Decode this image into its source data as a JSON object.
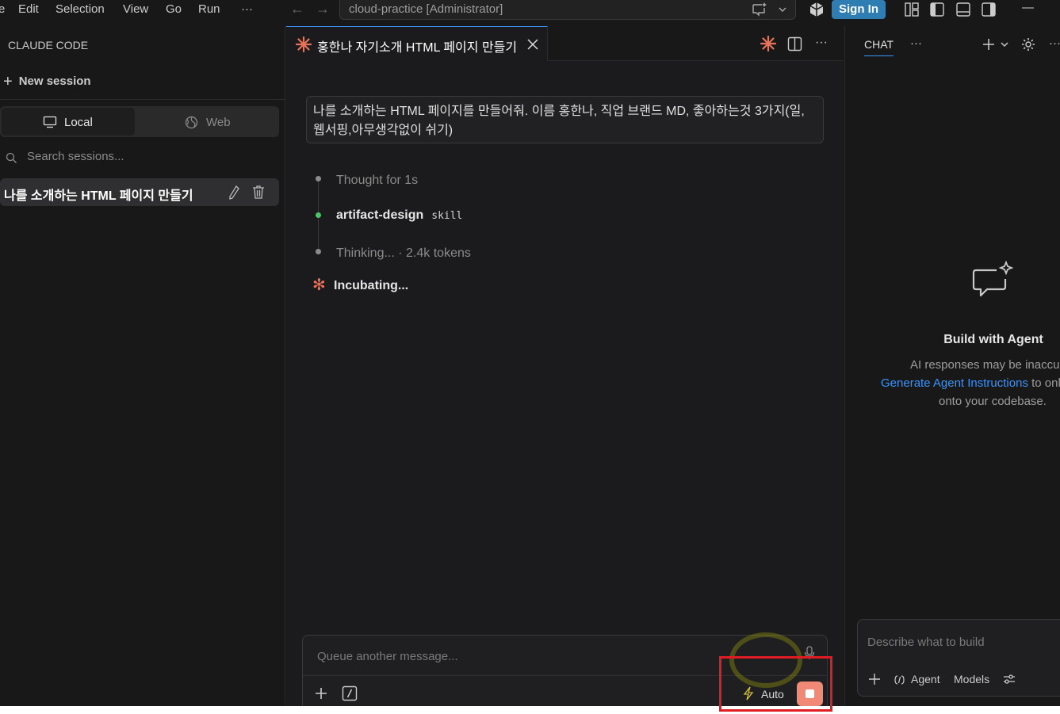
{
  "titlebar": {
    "menu": [
      "e",
      "Edit",
      "Selection",
      "View",
      "Go",
      "Run",
      "···"
    ],
    "command_center": "cloud-practice [Administrator]",
    "sign_in": "Sign In",
    "minimize": "—"
  },
  "sidebar": {
    "title": "CLAUDE CODE",
    "new_session": "New session",
    "mode_tabs": [
      {
        "label": "Local",
        "icon": "monitor-icon",
        "selected": true
      },
      {
        "label": "Web",
        "icon": "globe-icon",
        "selected": false
      }
    ],
    "search_placeholder": "Search sessions...",
    "sessions": [
      {
        "label": "나를 소개하는 HTML 페이지 만들기",
        "active": true
      }
    ]
  },
  "editor": {
    "tab_title": "홍한나 자기소개 HTML 페이지 만들기",
    "user_message": "나를 소개하는 HTML 페이지를 만들어줘. 이름 홍한나, 직업 브랜드 MD, 좋아하는것 3가지(일, 웹서핑,아무생각없이 쉬기)",
    "timeline": [
      {
        "text": "Thought for 1s",
        "status": "done"
      },
      {
        "text": "artifact-design",
        "tag": "skill",
        "status": "active"
      },
      {
        "text": "Thinking... · 2.4k tokens",
        "status": "pending"
      }
    ],
    "status": "Incubating...",
    "composer": {
      "placeholder": "Queue another message...",
      "mode_label": "Auto"
    }
  },
  "chat": {
    "tab": "CHAT",
    "more": "···",
    "title": "Build with Agent",
    "line1": "AI responses may be inaccura",
    "link": "Generate Agent Instructions",
    "line2_rest": " to onl",
    "line3": "onto your codebase.",
    "input_placeholder": "Describe what to build",
    "agent_label": "Agent",
    "models_label": "Models"
  },
  "colors": {
    "accent": "#3794ff",
    "claude_orange": "#e8735a",
    "stop_button": "#f08a76",
    "annotation": "#e11b22"
  }
}
